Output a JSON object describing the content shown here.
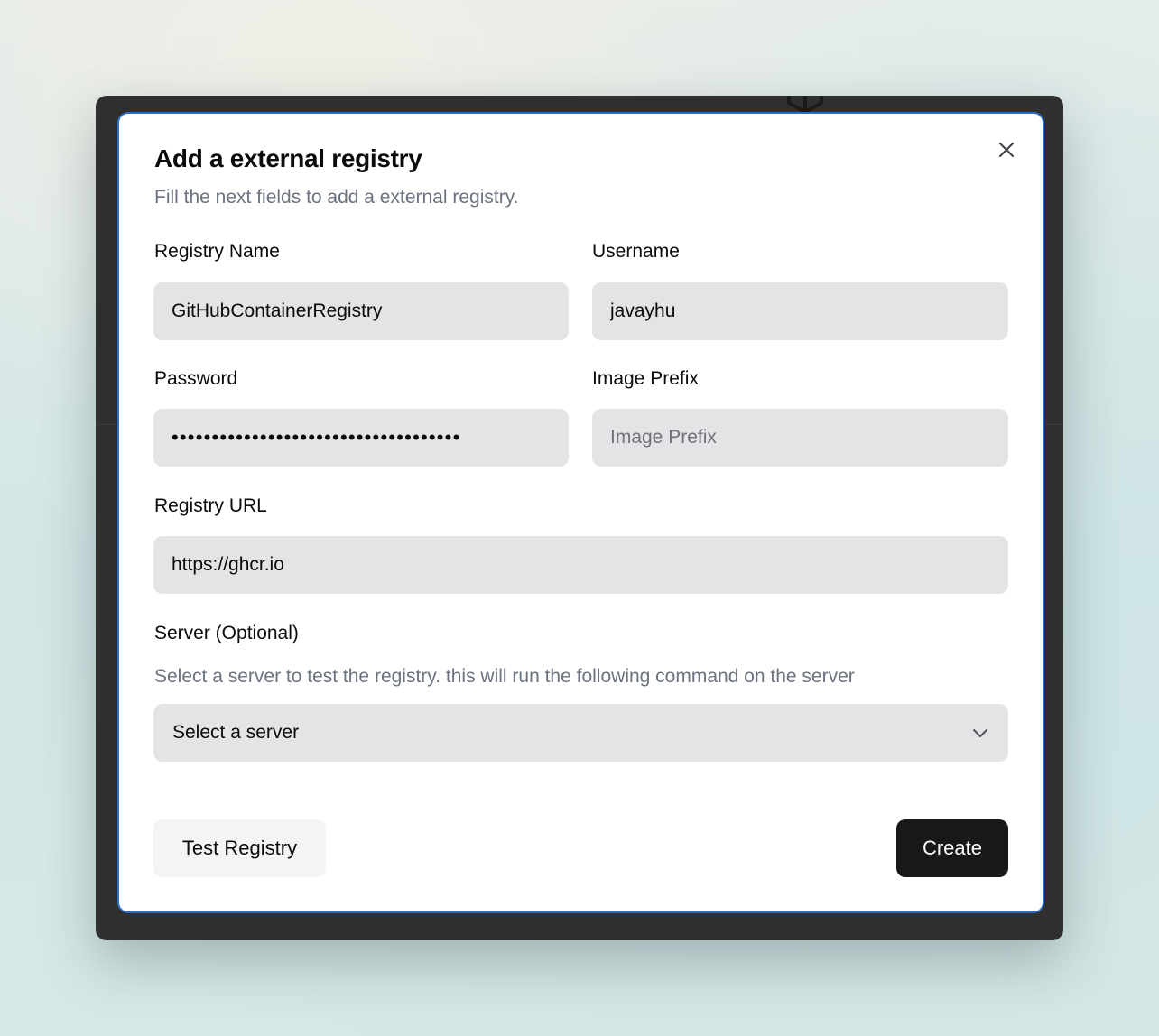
{
  "dialog": {
    "title": "Add a external registry",
    "subtitle": "Fill the next fields to add a external registry."
  },
  "fields": {
    "registry_name": {
      "label": "Registry Name",
      "value": "GitHubContainerRegistry"
    },
    "username": {
      "label": "Username",
      "value": "javayhu"
    },
    "password": {
      "label": "Password",
      "value": "••••••••••••••••••••••••••••••••••••"
    },
    "image_prefix": {
      "label": "Image Prefix",
      "value": "",
      "placeholder": "Image Prefix"
    },
    "registry_url": {
      "label": "Registry URL",
      "value": "https://ghcr.io"
    }
  },
  "server": {
    "label": "Server (Optional)",
    "hint": "Select a server to test the registry. this will run the following command on the server",
    "selected": "Select a server"
  },
  "actions": {
    "test_label": "Test Registry",
    "create_label": "Create"
  },
  "icons": {
    "close": "close-icon",
    "chevron": "chevron-down-icon",
    "background_logo": "logo-icon"
  },
  "colors": {
    "dialog_border": "#2b6cc4",
    "primary_button": "#18181b",
    "input_background": "#e4e4e7"
  }
}
